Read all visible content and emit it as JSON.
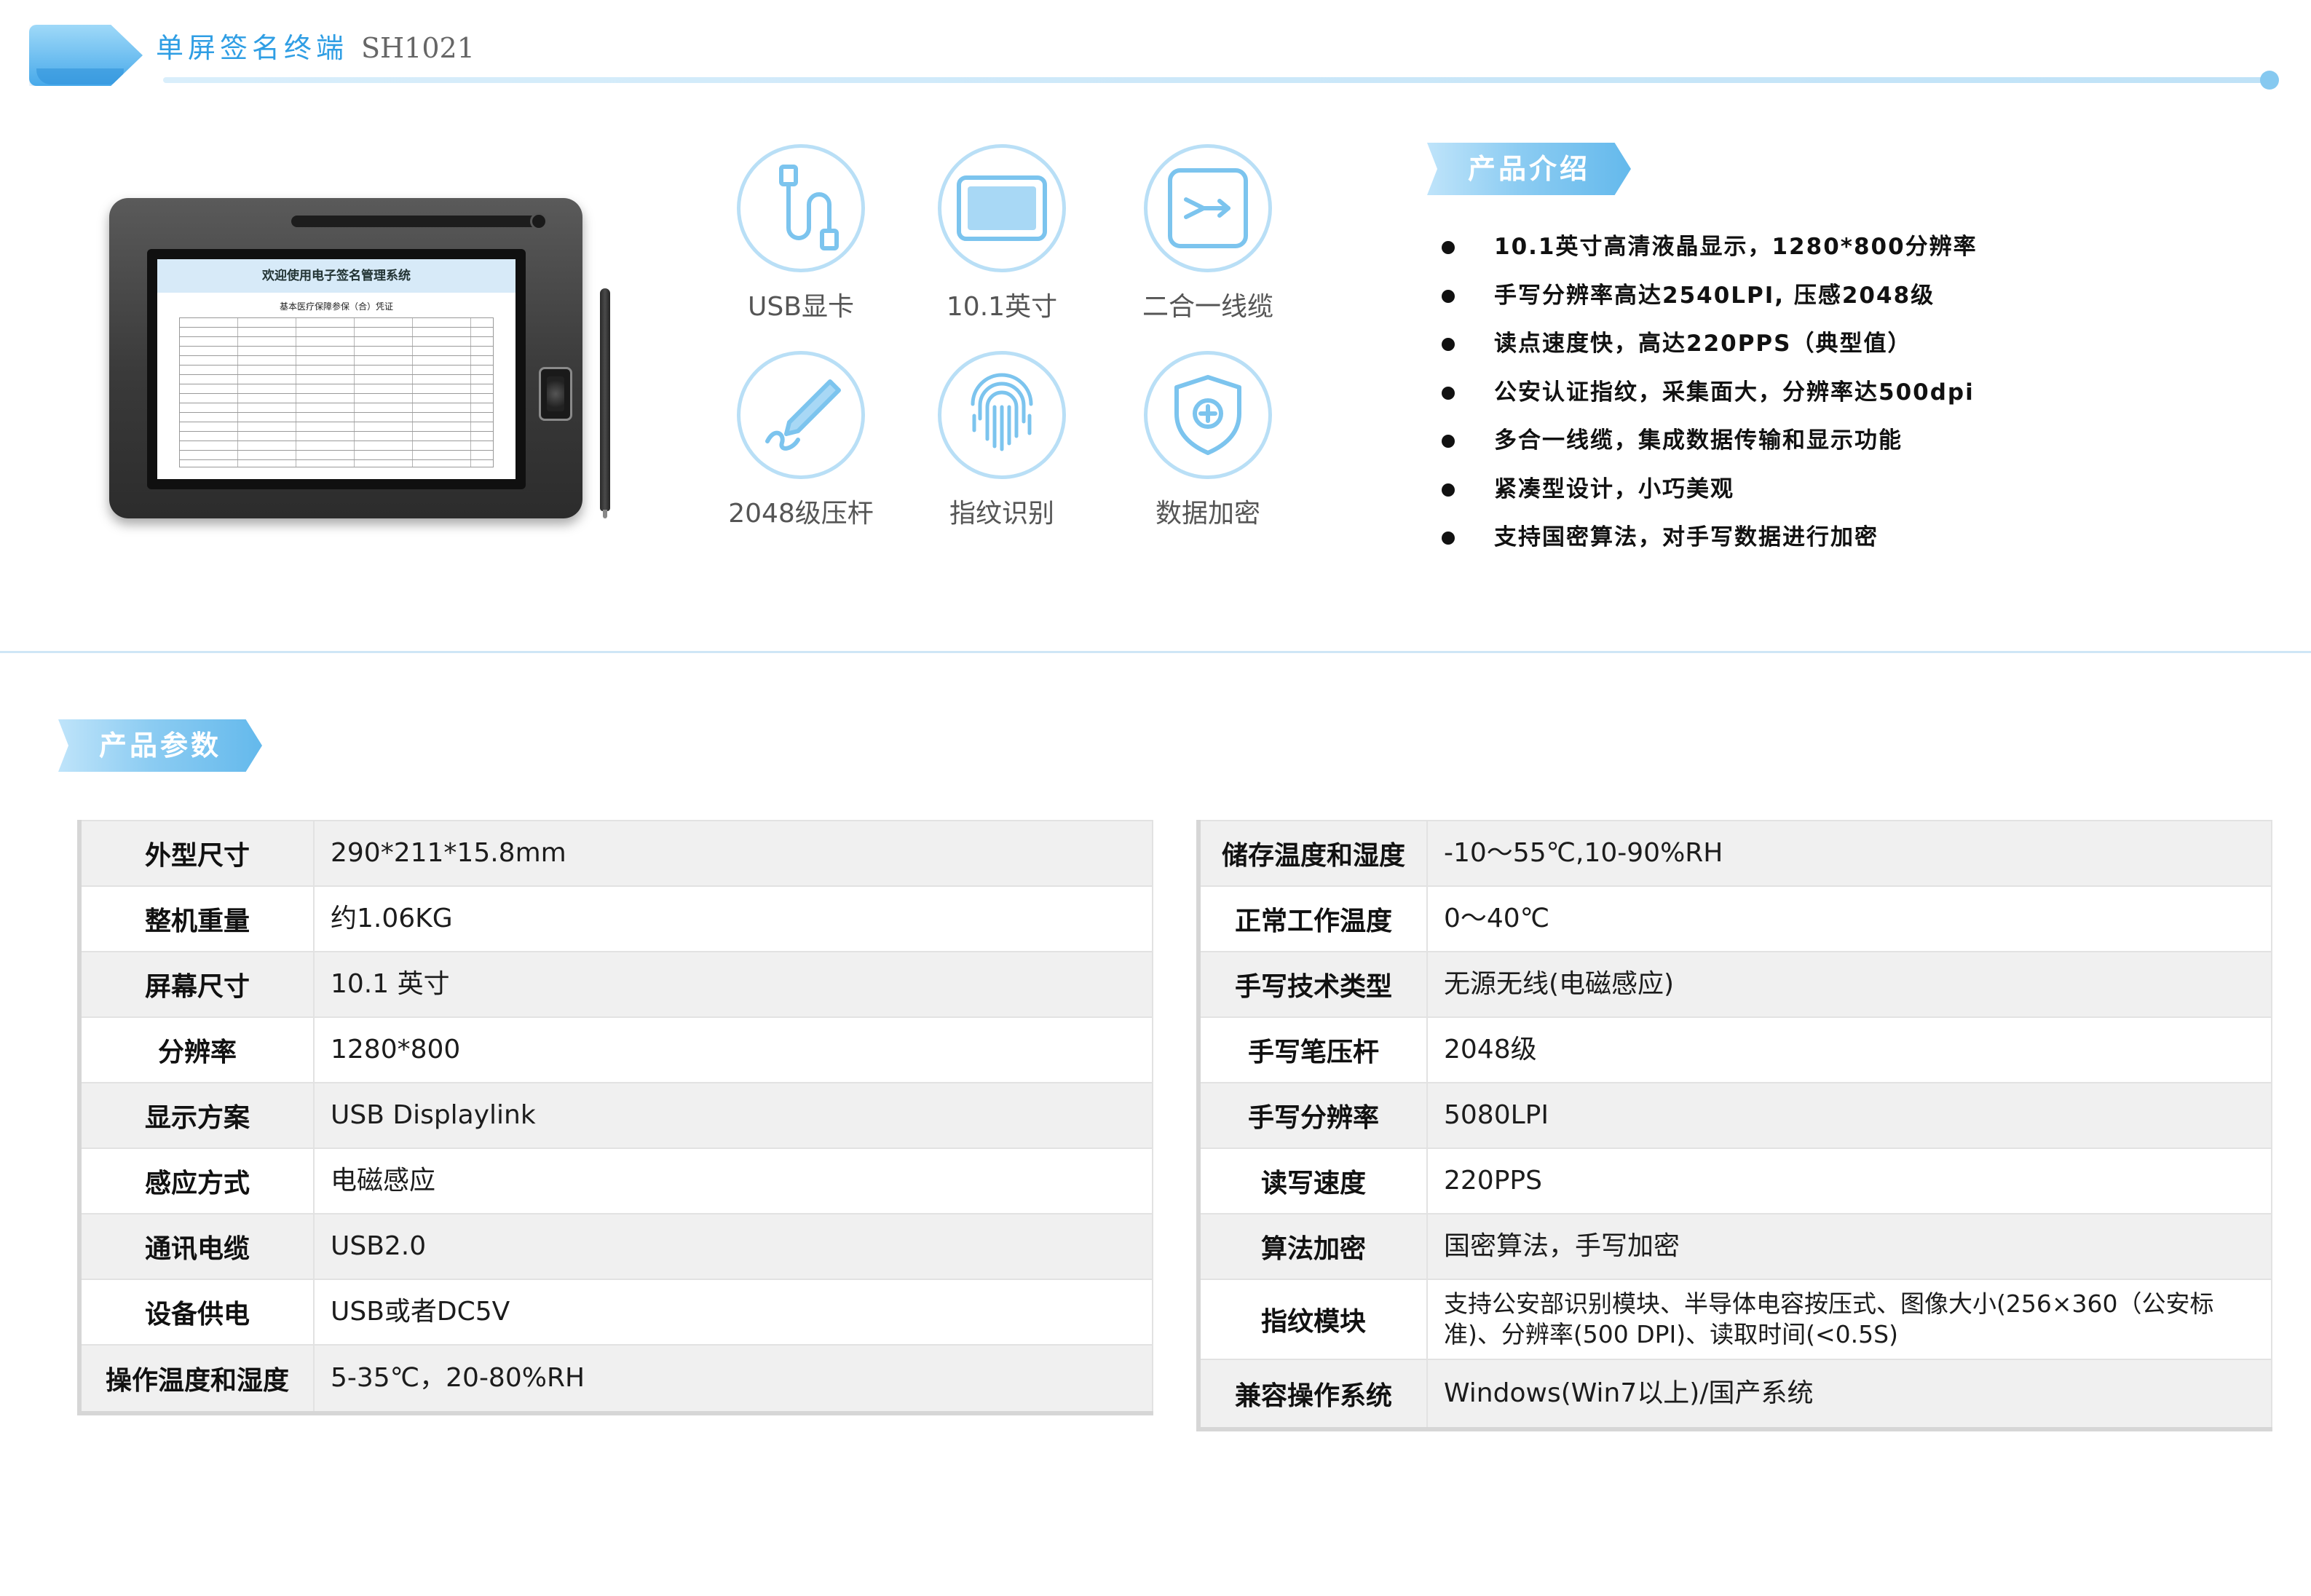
{
  "header": {
    "title": "单屏签名终端",
    "model": "SH1021"
  },
  "device": {
    "screen_heading": "欢迎使用电子签名管理系统",
    "screen_subheading": "基本医疗保障参保（合）凭证"
  },
  "features": [
    {
      "label": "USB显卡",
      "icon": "usb-cable-icon"
    },
    {
      "label": "10.1英寸",
      "icon": "screen-icon"
    },
    {
      "label": "二合一线缆",
      "icon": "merge-cable-icon"
    },
    {
      "label": "2048级压杆",
      "icon": "pen-pressure-icon"
    },
    {
      "label": "指纹识别",
      "icon": "fingerprint-icon"
    },
    {
      "label": "数据加密",
      "icon": "shield-icon"
    }
  ],
  "intro": {
    "heading": "产品介绍",
    "items": [
      "10.1英寸高清液晶显示，1280*800分辨率",
      "手写分辨率高达2540LPI, 压感2048级",
      "读点速度快，高达220PPS（典型值）",
      "公安认证指纹，采集面大，分辨率达500dpi",
      "多合一线缆，集成数据传输和显示功能",
      "紧凑型设计，小巧美观",
      "支持国密算法，对手写数据进行加密"
    ]
  },
  "params": {
    "heading": "产品参数",
    "left": [
      {
        "key": "外型尺寸",
        "value": "290*211*15.8mm"
      },
      {
        "key": "整机重量",
        "value": "约1.06KG"
      },
      {
        "key": "屏幕尺寸",
        "value": "10.1 英寸"
      },
      {
        "key": "分辨率",
        "value": "1280*800"
      },
      {
        "key": "显示方案",
        "value": "USB Displaylink"
      },
      {
        "key": "感应方式",
        "value": "电磁感应"
      },
      {
        "key": "通讯电缆",
        "value": "USB2.0"
      },
      {
        "key": "设备供电",
        "value": "USB或者DC5V"
      },
      {
        "key": "操作温度和湿度",
        "value": "5-35℃，20-80%RH"
      }
    ],
    "right": [
      {
        "key": "储存温度和湿度",
        "value": "-10～55℃,10-90%RH"
      },
      {
        "key": "正常工作温度",
        "value": "0～40℃"
      },
      {
        "key": "手写技术类型",
        "value": "无源无线(电磁感应)"
      },
      {
        "key": "手写笔压杆",
        "value": "2048级"
      },
      {
        "key": "手写分辨率",
        "value": "5080LPI"
      },
      {
        "key": "读写速度",
        "value": "220PPS"
      },
      {
        "key": "算法加密",
        "value": "国密算法，手写加密"
      },
      {
        "key": "指纹模块",
        "value": "支持公安部识别模块、半导体电容按压式、图像大小(256×360（公安标准)、分辨率(500 DPI)、读取时间(<0.5S)"
      },
      {
        "key": "兼容操作系统",
        "value": "Windows(Win7以上)/国产系统"
      }
    ]
  },
  "colors": {
    "accent": "#2f9ee4",
    "icon_stroke": "#7cc4ee",
    "ribbon": "#64b9ec"
  }
}
